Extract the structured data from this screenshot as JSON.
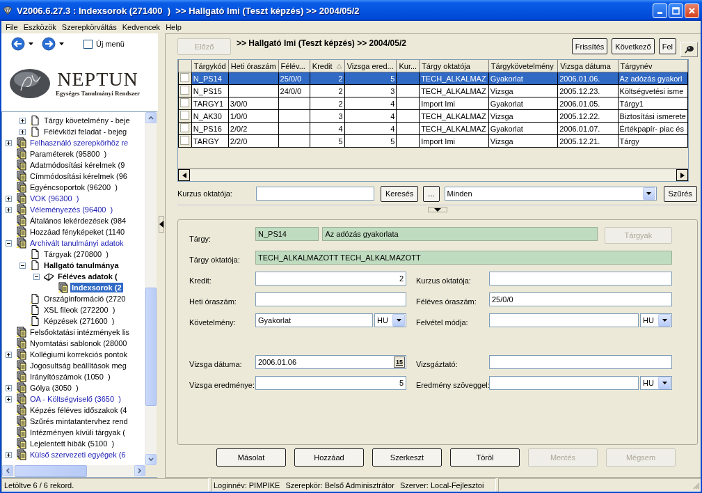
{
  "window": {
    "title": "V2006.6.27.3 : Indexsorok (271400  )  >> Hallgató Imi (Teszt képzés) >> 2004/05/2"
  },
  "menu": [
    "File",
    "Eszközök",
    "Szerepkörváltás",
    "Kedvencek",
    "Help"
  ],
  "nav": {
    "new_menu": {
      "label": "Új menü",
      "checked": false
    }
  },
  "logo": {
    "name": "NEPTUN",
    "subtitle": "Egységes Tanulmányi Rendszer"
  },
  "tree": [
    {
      "children": [
        {
          "label": "Tárgy követelmény - beje",
          "kind": "page",
          "linked": false,
          "selected": false,
          "bold": false,
          "expanded": false
        },
        {
          "label": "Félévközi feladat - bejeg",
          "kind": "page",
          "linked": false,
          "selected": false,
          "bold": false,
          "expanded": false
        }
      ]
    },
    {
      "label": "Felhasználó szerepkörhöz re",
      "kind": "module",
      "linked": true,
      "selected": false,
      "bold": false,
      "expanded": false
    },
    {
      "label": "Paraméterek (95800  )",
      "kind": "module",
      "linked": false,
      "selected": false,
      "bold": false
    },
    {
      "label": "Adatmódosítási kérelmek (9",
      "kind": "module",
      "linked": false,
      "selected": false,
      "bold": false
    },
    {
      "label": "Címmódosítási kérelmek (96",
      "kind": "module",
      "linked": false,
      "selected": false,
      "bold": false
    },
    {
      "label": "Egyéncsoportok (96200  )",
      "kind": "module",
      "linked": false,
      "selected": false,
      "bold": false
    },
    {
      "label": "VOK (96300  )",
      "kind": "module",
      "linked": true,
      "selected": false,
      "bold": false,
      "expanded": false
    },
    {
      "label": "Véleményezés (96400  )",
      "kind": "module",
      "linked": true,
      "selected": false,
      "bold": false,
      "expanded": false
    },
    {
      "label": "Általános lekérdezések (984",
      "kind": "module",
      "linked": false,
      "selected": false,
      "bold": false
    },
    {
      "label": "Hozzáad fényképeket (1140",
      "kind": "module",
      "linked": false,
      "selected": false,
      "bold": false
    },
    {
      "label": "Archivált tanulmányi adatok",
      "kind": "module",
      "linked": true,
      "selected": false,
      "bold": false,
      "expanded": true,
      "children": [
        {
          "label": "Tárgyak (270800  )",
          "kind": "page",
          "linked": false,
          "selected": false,
          "bold": false
        },
        {
          "label": "Hallgató tanulmánya",
          "kind": "page",
          "linked": false,
          "selected": false,
          "bold": true,
          "expanded": true,
          "children": [
            {
              "label": "Féléves adatok (",
              "kind": "book",
              "linked": false,
              "selected": false,
              "bold": true,
              "expanded": true,
              "children": [
                {
                  "label": "Indexsorok (2",
                  "kind": "module",
                  "linked": false,
                  "selected": true,
                  "bold": true
                }
              ]
            }
          ]
        },
        {
          "label": "Országinformáció (2720",
          "kind": "page",
          "linked": false,
          "selected": false,
          "bold": false
        },
        {
          "label": "XSL fileok (272200  )",
          "kind": "page",
          "linked": false,
          "selected": false,
          "bold": false
        },
        {
          "label": "Képzések (271600  )",
          "kind": "page",
          "linked": false,
          "selected": false,
          "bold": false
        }
      ]
    },
    {
      "label": "Felsőoktatási intézmények lis",
      "kind": "module",
      "linked": false,
      "selected": false,
      "bold": false
    },
    {
      "label": "Nyomtatási sablonok (28000",
      "kind": "module",
      "linked": false,
      "selected": false,
      "bold": false
    },
    {
      "label": "Kollégiumi korrekciós pontok",
      "kind": "module",
      "linked": false,
      "selected": false,
      "bold": false,
      "expanded": false
    },
    {
      "label": "Jogosultság beállítások meg",
      "kind": "module",
      "linked": false,
      "selected": false,
      "bold": false
    },
    {
      "label": "Irányítószámok (1050  )",
      "kind": "module",
      "linked": false,
      "selected": false,
      "bold": false
    },
    {
      "label": "Gólya (3050  )",
      "kind": "module",
      "linked": false,
      "selected": false,
      "bold": false,
      "expanded": false
    },
    {
      "label": "OA - Költségviselő (3650  )",
      "kind": "module",
      "linked": true,
      "selected": false,
      "bold": false,
      "expanded": false
    },
    {
      "label": "Képzés féléves időszakok (4",
      "kind": "module",
      "linked": false,
      "selected": false,
      "bold": false
    },
    {
      "label": "Szűrés mintatantervhez rend",
      "kind": "module",
      "linked": false,
      "selected": false,
      "bold": false
    },
    {
      "label": "Intézményen kívüli tárgyak (",
      "kind": "module",
      "linked": false,
      "selected": false,
      "bold": false
    },
    {
      "label": "Lejelentett hibák (5100  )",
      "kind": "module",
      "linked": false,
      "selected": false,
      "bold": false
    },
    {
      "label": "Külső szervezeti egyégek (6",
      "kind": "module",
      "linked": true,
      "selected": false,
      "bold": false,
      "expanded": false
    }
  ],
  "toolbar": {
    "prev": {
      "label": "Előző",
      "disabled": true
    },
    "breadcrumb": ">> Hallgató Imi (Teszt képzés) >> 2004/05/2",
    "buttons": [
      {
        "label": "Frissítés",
        "disabled": false
      },
      {
        "label": "Következő",
        "disabled": false
      },
      {
        "label": "Fel",
        "disabled": false
      }
    ]
  },
  "grid": {
    "columns": [
      {
        "label": "Tárgykód",
        "sorted": false
      },
      {
        "label": "Heti óraszám",
        "sorted": false
      },
      {
        "label": "Félév...",
        "sorted": false
      },
      {
        "label": "Kredit",
        "sorted": true
      },
      {
        "label": "Vizsga ered...",
        "sorted": false
      },
      {
        "label": "Kur...",
        "sorted": false
      },
      {
        "label": "Tárgy oktatója",
        "sorted": false
      },
      {
        "label": "Tárgykövetelmény",
        "sorted": false
      },
      {
        "label": "Vizsga dátuma",
        "sorted": false
      },
      {
        "label": "Tárgynév",
        "sorted": false
      }
    ],
    "rows": [
      {
        "selected": true,
        "checked": false,
        "cells": [
          "N_PS14",
          null,
          "25/0/0",
          "2",
          "5",
          null,
          "TECH_ALKALMAZ",
          "Gyakorlat",
          "2006.01.06.",
          "Az adózás gyakorl"
        ]
      },
      {
        "selected": false,
        "checked": false,
        "cells": [
          "N_PS15",
          null,
          "24/0/0",
          "2",
          "3",
          null,
          "TECH_ALKALMAZ",
          "Vizsga",
          "2005.12.23.",
          "Költségvetési isme"
        ]
      },
      {
        "selected": false,
        "checked": false,
        "cells": [
          "TARGY1",
          "3/0/0",
          null,
          "2",
          "4",
          null,
          "Import Imi",
          "Gyakorlat",
          "2006.01.05.",
          "Tárgy1"
        ]
      },
      {
        "selected": false,
        "checked": false,
        "cells": [
          "N_AK30",
          "1/0/0",
          null,
          "3",
          "4",
          null,
          "TECH_ALKALMAZ",
          "Vizsga",
          "2005.12.22.",
          "Biztosítási ismerete"
        ]
      },
      {
        "selected": false,
        "checked": false,
        "cells": [
          "N_PS16",
          "2/0/2",
          null,
          "4",
          "4",
          null,
          "TECH_ALKALMAZ",
          "Gyakorlat",
          "2006.01.07.",
          "Értékpapír- piac és"
        ]
      },
      {
        "selected": false,
        "checked": false,
        "cells": [
          "TARGY",
          "2/2/0",
          null,
          "5",
          "5",
          null,
          "Import Imi",
          "Vizsga",
          "2005.12.21.",
          "Tárgy"
        ]
      }
    ]
  },
  "filter": {
    "label": "Kurzus oktatója:",
    "search": "Keresés",
    "more": "...",
    "dropdown": "Minden",
    "apply": "Szűrés"
  },
  "form": {
    "subject": {
      "label": "Tárgy:",
      "code": "N_PS14",
      "name": "Az adózás gyakorlata",
      "browse": {
        "label": "Tárgyak",
        "disabled": true
      }
    },
    "teacher": {
      "label": "Tárgy oktatója:",
      "value": "TECH_ALKALMAZOTT TECH_ALKALMAZOTT"
    },
    "sections": [
      {
        "rows": [
          {
            "fields": [
              {
                "label": "Kredit:",
                "kind": "number",
                "value": "2"
              },
              {
                "label": "Kurzus oktatója:",
                "kind": "text"
              }
            ]
          },
          {
            "fields": [
              {
                "label": "Heti óraszám:",
                "kind": "text"
              },
              {
                "label": "Féléves óraszám:",
                "kind": "text",
                "value": "25/0/0"
              }
            ]
          },
          {
            "fields": [
              {
                "label": "Követelmény:",
                "kind": "lang",
                "value": "Gyakorlat",
                "lang": "HU"
              },
              {
                "label": "Felvétel módja:",
                "kind": "lang",
                "lang": "HU"
              }
            ]
          }
        ]
      },
      {
        "rows": [
          {
            "fields": [
              {
                "label": "Vizsga dátuma:",
                "kind": "date",
                "value": "2006.01.06",
                "calendar": "15"
              },
              {
                "label": "Vizsgáztató:",
                "kind": "text"
              }
            ]
          },
          {
            "fields": [
              {
                "label": "Vizsga eredménye:",
                "kind": "number",
                "value": "5"
              },
              {
                "label": "Eredmény szöveggel:",
                "kind": "lang",
                "lang": "HU"
              }
            ]
          }
        ]
      }
    ]
  },
  "actions": [
    {
      "label": "Másolat",
      "disabled": false
    },
    {
      "label": "Hozzáad",
      "disabled": false
    },
    {
      "label": "Szerkeszt",
      "disabled": false
    },
    {
      "label": "Töröl",
      "disabled": false
    },
    {
      "label": "Mentés",
      "disabled": true
    },
    {
      "label": "Mégsem",
      "disabled": true
    }
  ],
  "status_bar": {
    "records": "Letöltve 6 / 6 rekord.",
    "session": [
      "Loginnév: PIMPIKE",
      "Szerepkör: Belső Adminisztrátor",
      "Szerver: Local-Fejlesztoi"
    ]
  }
}
